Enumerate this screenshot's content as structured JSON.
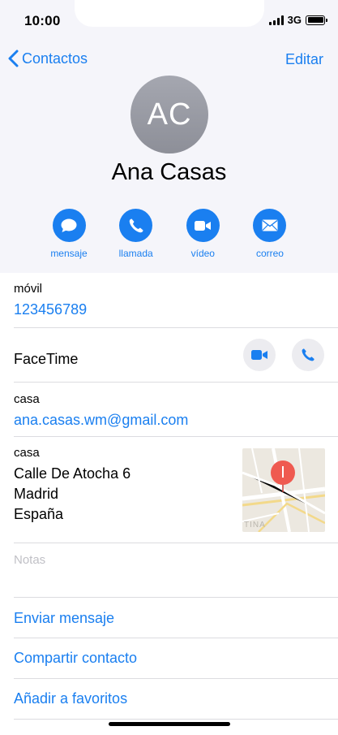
{
  "status_bar": {
    "time": "10:00",
    "network": "3G"
  },
  "nav": {
    "back_label": "Contactos",
    "edit_label": "Editar"
  },
  "contact": {
    "initials": "AC",
    "name": "Ana Casas"
  },
  "actions": [
    {
      "label": "mensaje",
      "icon": "message-bubble-icon"
    },
    {
      "label": "llamada",
      "icon": "phone-icon"
    },
    {
      "label": "vídeo",
      "icon": "video-icon"
    },
    {
      "label": "correo",
      "icon": "mail-icon"
    }
  ],
  "phone": {
    "label": "móvil",
    "value": "123456789"
  },
  "facetime": {
    "label": "FaceTime"
  },
  "email": {
    "label": "casa",
    "value": "ana.casas.wm@gmail.com"
  },
  "address": {
    "label": "casa",
    "lines": [
      "Calle De Atocha 6",
      "Madrid",
      "España"
    ],
    "map_text": "TINA"
  },
  "notes": {
    "placeholder": "Notas"
  },
  "links": [
    "Enviar mensaje",
    "Compartir contacto",
    "Añadir a favoritos"
  ],
  "colors": {
    "accent": "#1a7ff0",
    "header_bg": "#f5f5fa",
    "separator": "#dcdce0"
  }
}
